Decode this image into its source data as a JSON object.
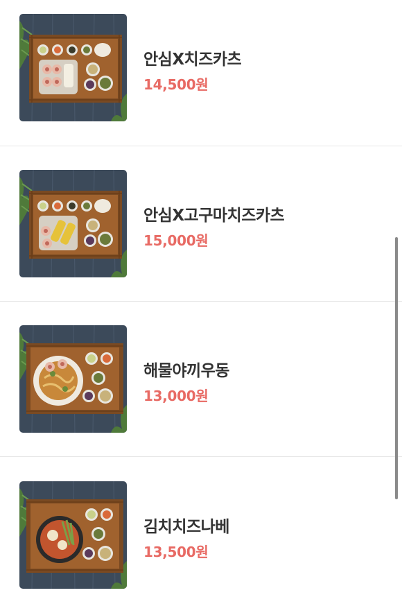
{
  "menu": {
    "items": [
      {
        "name": "안심X치즈카츠",
        "price": "14,500원",
        "image": "tray-katsu-set"
      },
      {
        "name": "안심X고구마치즈카츠",
        "price": "15,000원",
        "image": "tray-sweetpotato-katsu-set"
      },
      {
        "name": "해물야끼우동",
        "price": "13,000원",
        "image": "tray-yaki-udon-set"
      },
      {
        "name": "김치치즈나베",
        "price": "13,500원",
        "image": "tray-kimchi-nabe-set"
      }
    ]
  },
  "colors": {
    "price": "#e86a64",
    "name": "#333333",
    "divider": "#e6e6e6",
    "wood_background": "#3c4a5a",
    "tray": "#a0622e"
  }
}
